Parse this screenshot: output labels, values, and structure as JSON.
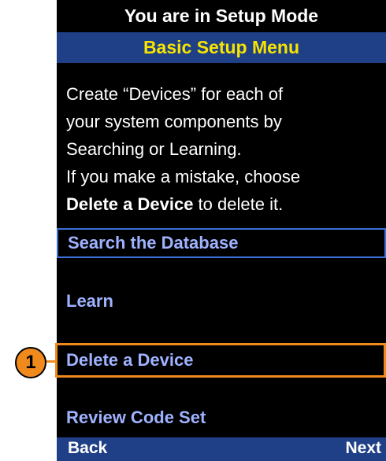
{
  "header": {
    "title": "You are in Setup Mode",
    "subtitle": "Basic Setup Menu"
  },
  "instructions": {
    "line1": "Create “Devices” for each of",
    "line2": "your system components by",
    "line3": "Searching or Learning.",
    "line4": "If you make a mistake, choose",
    "line5_bold": "Delete a Device",
    "line5_rest": " to delete it."
  },
  "menu": {
    "items": [
      {
        "label": "Search the Database",
        "selected": true
      },
      {
        "label": "Learn",
        "selected": false
      },
      {
        "label": "Delete a Device",
        "selected": false
      },
      {
        "label": "Review Code Set",
        "selected": false
      }
    ]
  },
  "softkeys": {
    "left": "Back",
    "right": "Next"
  },
  "callout": {
    "number": "1"
  },
  "colors": {
    "background": "#000000",
    "header_bar": "#1f3f86",
    "subtitle_text": "#f6e400",
    "menu_text": "#9fb2ff",
    "selection_border": "#3a6fd6",
    "callout_orange": "#f08a1c"
  }
}
